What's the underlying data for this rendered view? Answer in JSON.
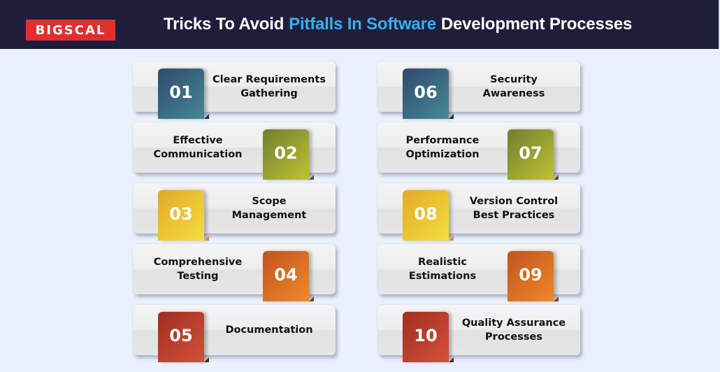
{
  "header": {
    "logo_text": "BIGSCAL",
    "title_prefix": "Tricks To Avoid",
    "title_accent": "Pitfalls In Software",
    "title_suffix": "Development Processes",
    "colors": {
      "background": "#1f1e3a",
      "accent": "#3aaef0",
      "logo": "#e02f2f"
    }
  },
  "items": [
    {
      "number": "01",
      "line1": "Clear Requirements",
      "line2": "Gathering",
      "color": "teal"
    },
    {
      "number": "02",
      "line1": "Effective",
      "line2": "Communication",
      "color": "olive"
    },
    {
      "number": "03",
      "line1": "Scope",
      "line2": "Management",
      "color": "yellow"
    },
    {
      "number": "04",
      "line1": "Comprehensive",
      "line2": "Testing",
      "color": "orange"
    },
    {
      "number": "05",
      "line1": "Documentation",
      "line2": "",
      "color": "red"
    },
    {
      "number": "06",
      "line1": "Security",
      "line2": "Awareness",
      "color": "teal"
    },
    {
      "number": "07",
      "line1": "Performance",
      "line2": "Optimization",
      "color": "olive"
    },
    {
      "number": "08",
      "line1": "Version Control",
      "line2": "Best Practices",
      "color": "yellow"
    },
    {
      "number": "09",
      "line1": "Realistic",
      "line2": "Estimations",
      "color": "orange"
    },
    {
      "number": "10",
      "line1": "Quality Assurance",
      "line2": "Processes",
      "color": "red"
    }
  ],
  "palette": {
    "teal": {
      "from": "#2f4a6e",
      "to": "#468896",
      "fold": "#1d2f3f"
    },
    "olive": {
      "from": "#6f7f2f",
      "to": "#c0c234",
      "fold": "#4e5a1f"
    },
    "yellow": {
      "from": "#e3a928",
      "to": "#f3df3f",
      "fold": "#e6892a"
    },
    "orange": {
      "from": "#c0531f",
      "to": "#ef8a2a",
      "fold": "#8d3a14"
    },
    "red": {
      "from": "#a02e22",
      "to": "#d4503a",
      "fold": "#6d1c15"
    }
  }
}
